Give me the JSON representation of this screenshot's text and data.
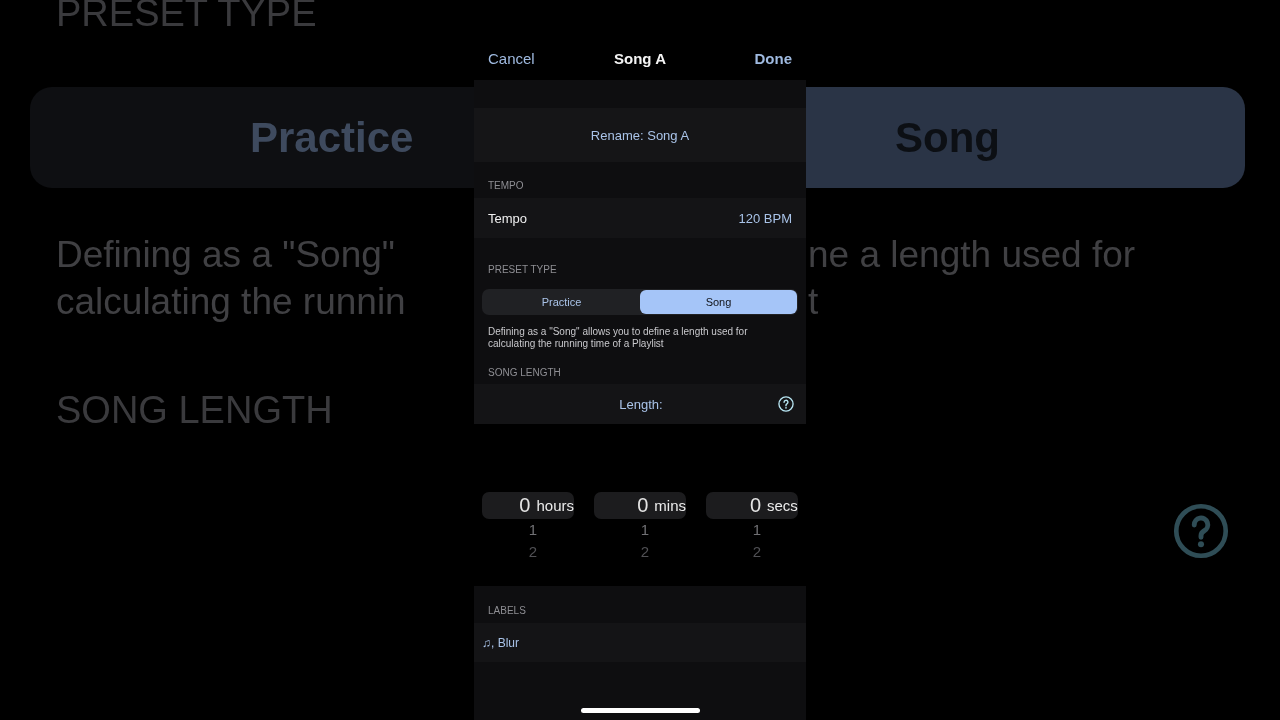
{
  "backdrop": {
    "left": {
      "top_header": "PRESET TYPE",
      "segment": {
        "label": "Practice",
        "selected": false
      },
      "description_lines": [
        "Defining as a \"Song\"",
        "calculating the runnin"
      ],
      "bottom_header": "SONG LENGTH"
    },
    "right": {
      "segment": {
        "label": "Song",
        "selected": true
      },
      "description_lines": [
        "ne a length used for",
        "t"
      ]
    }
  },
  "nav": {
    "cancel": "Cancel",
    "title": "Song A",
    "done": "Done"
  },
  "rename": {
    "label": "Rename: Song A"
  },
  "tempo": {
    "header": "TEMPO",
    "row": {
      "label": "Tempo",
      "value": "120 BPM"
    }
  },
  "preset_type": {
    "header": "PRESET TYPE",
    "segments": [
      {
        "label": "Practice",
        "selected": false
      },
      {
        "label": "Song",
        "selected": true
      }
    ],
    "footer": "Defining as a \"Song\" allows you to define a length used for calculating the running time of a Playlist"
  },
  "song_length": {
    "header": "SONG LENGTH",
    "row": {
      "label": "Length:"
    },
    "picker": [
      {
        "value": "0",
        "unit": "hours",
        "options": [
          "1",
          "2"
        ]
      },
      {
        "value": "0",
        "unit": "mins",
        "options": [
          "1",
          "2"
        ]
      },
      {
        "value": "0",
        "unit": "secs",
        "options": [
          "1",
          "2"
        ]
      }
    ]
  },
  "labels": {
    "header": "LABELS",
    "value": "♫, Blur"
  }
}
